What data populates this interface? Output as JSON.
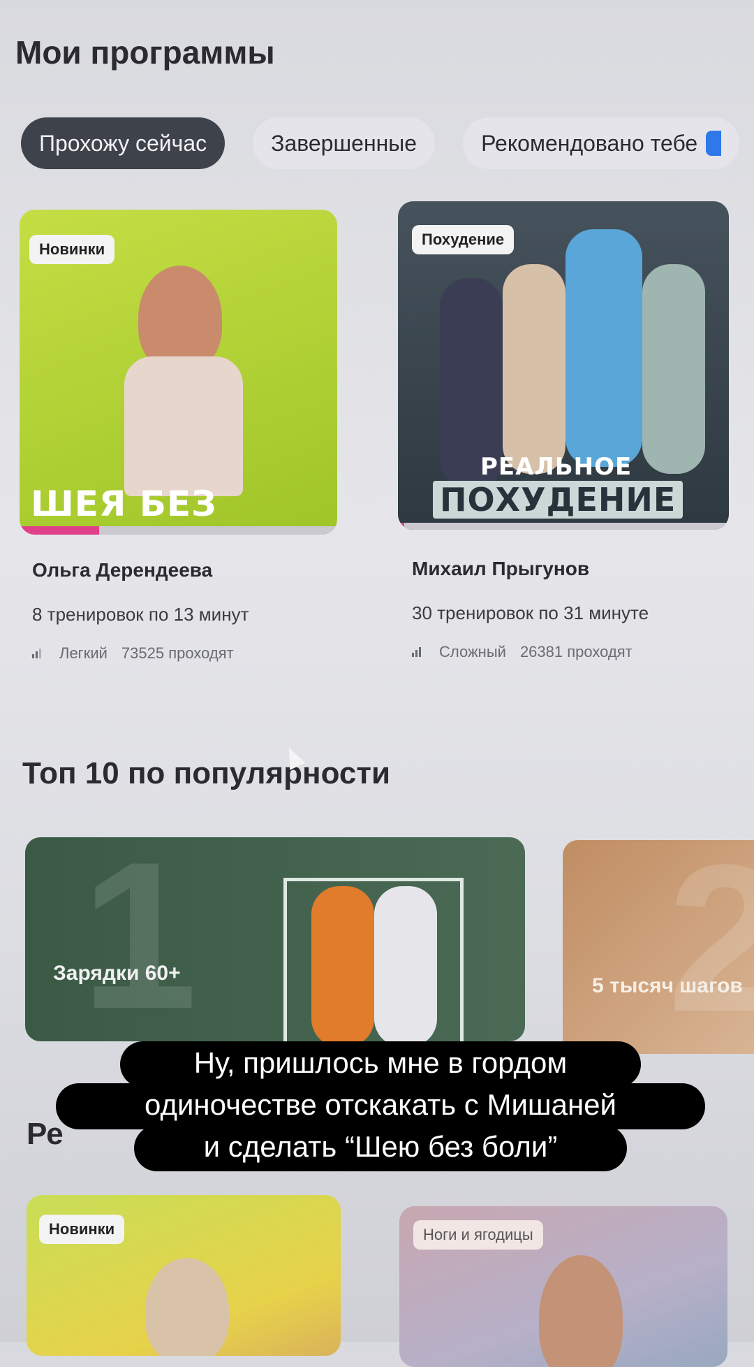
{
  "page_title": "Мои программы",
  "tabs": [
    {
      "label": "Прохожу сейчас",
      "active": true
    },
    {
      "label": "Завершенные",
      "active": false
    },
    {
      "label": "Рекомендовано тебе",
      "active": false
    }
  ],
  "programs": [
    {
      "badge": "Новинки",
      "headline": "ШЕЯ БЕЗ БОЛИ",
      "author": "Ольга Дерендеева",
      "workouts": "8 тренировок по 13 минут",
      "level": "Легкий",
      "participants": "73525 проходят",
      "progress": 0.25
    },
    {
      "badge": "Похудение",
      "headline_line1": "РЕАЛЬНОЕ",
      "headline_line2": "ПОХУДЕНИЕ",
      "author": "Михаил Прыгунов",
      "workouts": "30 тренировок по 31 минуте",
      "level": "Сложный",
      "participants": "26381 проходят",
      "progress": 0.02
    }
  ],
  "top_section_title": "Топ 10 по популярности",
  "top_items": [
    {
      "rank": "1",
      "title": "Зарядки 60+"
    },
    {
      "rank": "2",
      "title": "5 тысяч шагов"
    }
  ],
  "recommended_section_title": "Ре",
  "recommended_badges": [
    "Новинки",
    "Ноги и ягодицы"
  ],
  "caption_lines": [
    "Ну, пришлось мне в гордом",
    "одиночестве отскакать с Мишаней",
    "и сделать “Шею без боли”"
  ],
  "colors": {
    "accent_pink": "#e0408a",
    "tab_active": "#3e424b",
    "card1_bg": "#b6d23a",
    "card2_bg": "#3a4650",
    "top1_bg": "#3f5f4a",
    "top2_bg": "#c79a70"
  }
}
